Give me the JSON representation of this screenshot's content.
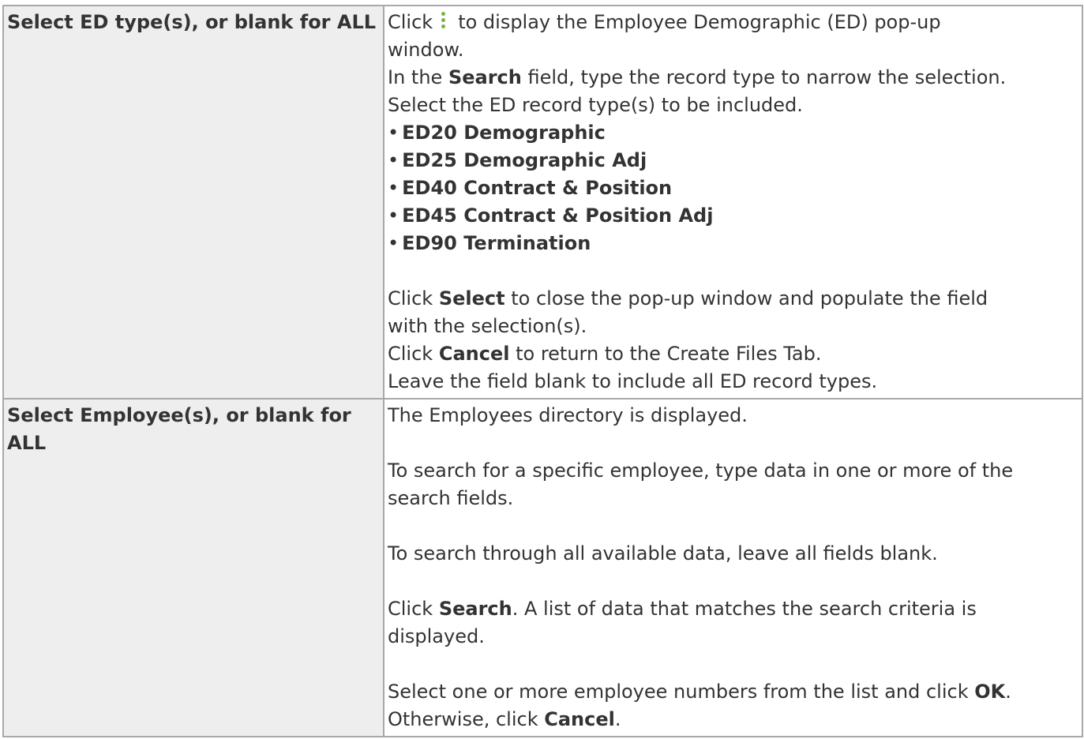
{
  "rows": [
    {
      "label": "Select ED type(s), or blank for ALL",
      "click_prefix": "Click",
      "click_suffix": "to display the Employee Demographic (ED) pop-up",
      "line_window": "window.",
      "search_pre": "In the",
      "search_bold": "Search",
      "search_post": "field, type the record type to narrow the selection.",
      "select_line": "Select the ED record type(s) to be included.",
      "items": [
        "ED20 Demographic",
        "ED25 Demographic Adj",
        "ED40 Contract & Position",
        "ED45 Contract & Position Adj",
        "ED90 Termination"
      ],
      "sel_pre": "Click",
      "sel_bold": "Select",
      "sel_post": "to close the pop-up window and populate the field",
      "sel_post2": "with the selection(s).",
      "cancel_pre": "Click",
      "cancel_bold": "Cancel",
      "cancel_post": "to return to the Create Files Tab.",
      "leave_line": "Leave the field blank to include all ED record types."
    },
    {
      "label": "Select Employee(s), or blank for ALL",
      "dir_line": "The Employees directory is displayed.",
      "spec_line1": "To search for a specific employee, type data in one or more of the",
      "spec_line2": "search fields.",
      "all_line": "To search through all available data, leave all fields blank.",
      "search_pre": "Click",
      "search_bold": "Search",
      "search_post": ". A list of data that matches the search criteria is",
      "search_post2": "displayed.",
      "ok_pre": "Select one or more employee numbers from the list and click",
      "ok_bold": "OK",
      "ok_post": ".",
      "other_pre": "Otherwise, click",
      "other_bold": "Cancel",
      "other_post": "."
    }
  ],
  "icons": {
    "kebab": "vertical-ellipsis-icon",
    "kebab_color": "#7cb342"
  }
}
